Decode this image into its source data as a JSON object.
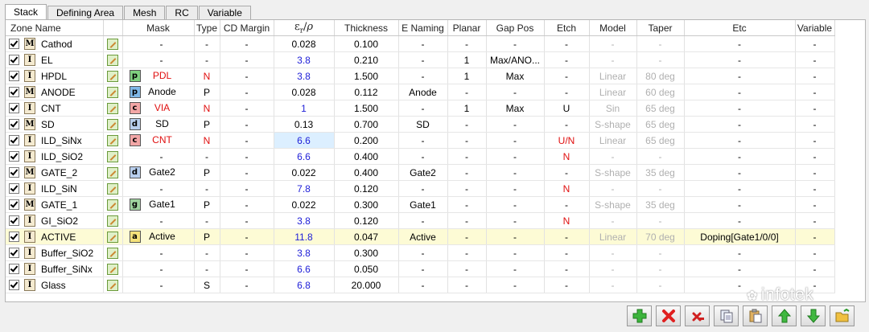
{
  "tabs": [
    "Stack",
    "Defining Area",
    "Mesh",
    "RC",
    "Variable"
  ],
  "active_tab": "Stack",
  "columns": [
    "Zone Name",
    "",
    "Mask",
    "Type",
    "CD Margin",
    "εr/ρ",
    "Thickness",
    "E Naming",
    "Planar",
    "Gap Pos",
    "Etch",
    "Model",
    "Taper",
    "Etc",
    "Variable"
  ],
  "rows": [
    {
      "name": "Cathod",
      "zt": "M",
      "mask_icon": "",
      "mask": "-",
      "type": "-",
      "cd": "-",
      "eps": "0.028",
      "thick": "0.100",
      "enaming": "-",
      "planar": "-",
      "gap": "-",
      "etch": "-",
      "model": "-",
      "taper": "-",
      "etc": "-",
      "variable": "-"
    },
    {
      "name": "EL",
      "zt": "I",
      "mask_icon": "",
      "mask": "-",
      "type": "-",
      "cd": "-",
      "eps": "3.8",
      "thick": "0.210",
      "enaming": "-",
      "planar": "1",
      "gap": "Max/ANO...",
      "etch": "-",
      "model": "-",
      "taper": "-",
      "etc": "-",
      "variable": "-"
    },
    {
      "name": "HPDL",
      "zt": "I",
      "mask_icon": "p",
      "mask": "PDL",
      "type": "N",
      "cd": "-",
      "eps": "3.8",
      "thick": "1.500",
      "enaming": "-",
      "planar": "1",
      "gap": "Max",
      "etch": "-",
      "model": "Linear",
      "taper": "80 deg",
      "etc": "-",
      "variable": "-"
    },
    {
      "name": "ANODE",
      "zt": "M",
      "mask_icon": "p",
      "mask": "Anode",
      "type": "P",
      "cd": "-",
      "eps": "0.028",
      "thick": "0.112",
      "enaming": "Anode",
      "planar": "-",
      "gap": "-",
      "etch": "-",
      "model": "Linear",
      "taper": "60 deg",
      "etc": "-",
      "variable": "-"
    },
    {
      "name": "CNT",
      "zt": "I",
      "mask_icon": "c",
      "mask": "VIA",
      "type": "N",
      "cd": "-",
      "eps": "1",
      "thick": "1.500",
      "enaming": "-",
      "planar": "1",
      "gap": "Max",
      "etch": "U",
      "model": "Sin",
      "taper": "65 deg",
      "etc": "-",
      "variable": "-"
    },
    {
      "name": "SD",
      "zt": "M",
      "mask_icon": "d",
      "mask": "SD",
      "type": "P",
      "cd": "-",
      "eps": "0.13",
      "thick": "0.700",
      "enaming": "SD",
      "planar": "-",
      "gap": "-",
      "etch": "-",
      "model": "S-shape",
      "taper": "65 deg",
      "etc": "-",
      "variable": "-"
    },
    {
      "name": "ILD_SiNx",
      "zt": "I",
      "mask_icon": "c",
      "mask": "CNT",
      "type": "N",
      "cd": "-",
      "eps": "6.6",
      "thick": "0.200",
      "enaming": "-",
      "planar": "-",
      "gap": "-",
      "etch": "U/N",
      "model": "Linear",
      "taper": "65 deg",
      "etc": "-",
      "variable": "-"
    },
    {
      "name": "ILD_SiO2",
      "zt": "I",
      "mask_icon": "",
      "mask": "-",
      "type": "-",
      "cd": "-",
      "eps": "6.6",
      "thick": "0.400",
      "enaming": "-",
      "planar": "-",
      "gap": "-",
      "etch": "N",
      "model": "-",
      "taper": "-",
      "etc": "-",
      "variable": "-"
    },
    {
      "name": "GATE_2",
      "zt": "M",
      "mask_icon": "d",
      "mask": "Gate2",
      "type": "P",
      "cd": "-",
      "eps": "0.022",
      "thick": "0.400",
      "enaming": "Gate2",
      "planar": "-",
      "gap": "-",
      "etch": "-",
      "model": "S-shape",
      "taper": "35 deg",
      "etc": "-",
      "variable": "-"
    },
    {
      "name": "ILD_SiN",
      "zt": "I",
      "mask_icon": "",
      "mask": "-",
      "type": "-",
      "cd": "-",
      "eps": "7.8",
      "thick": "0.120",
      "enaming": "-",
      "planar": "-",
      "gap": "-",
      "etch": "N",
      "model": "-",
      "taper": "-",
      "etc": "-",
      "variable": "-"
    },
    {
      "name": "GATE_1",
      "zt": "M",
      "mask_icon": "g",
      "mask": "Gate1",
      "type": "P",
      "cd": "-",
      "eps": "0.022",
      "thick": "0.300",
      "enaming": "Gate1",
      "planar": "-",
      "gap": "-",
      "etch": "-",
      "model": "S-shape",
      "taper": "35 deg",
      "etc": "-",
      "variable": "-"
    },
    {
      "name": "GI_SiO2",
      "zt": "I",
      "mask_icon": "",
      "mask": "-",
      "type": "-",
      "cd": "-",
      "eps": "3.8",
      "thick": "0.120",
      "enaming": "-",
      "planar": "-",
      "gap": "-",
      "etch": "N",
      "model": "-",
      "taper": "-",
      "etc": "-",
      "variable": "-"
    },
    {
      "name": "ACTIVE",
      "zt": "I",
      "mask_icon": "a",
      "mask": "Active",
      "type": "P",
      "cd": "-",
      "eps": "11.8",
      "thick": "0.047",
      "enaming": "Active",
      "planar": "-",
      "gap": "-",
      "etch": "-",
      "model": "Linear",
      "taper": "70 deg",
      "etc": "Doping[Gate1/0/0]",
      "variable": "-"
    },
    {
      "name": "Buffer_SiO2",
      "zt": "I",
      "mask_icon": "",
      "mask": "-",
      "type": "-",
      "cd": "-",
      "eps": "3.8",
      "thick": "0.300",
      "enaming": "-",
      "planar": "-",
      "gap": "-",
      "etch": "-",
      "model": "-",
      "taper": "-",
      "etc": "-",
      "variable": "-"
    },
    {
      "name": "Buffer_SiNx",
      "zt": "I",
      "mask_icon": "",
      "mask": "-",
      "type": "-",
      "cd": "-",
      "eps": "6.6",
      "thick": "0.050",
      "enaming": "-",
      "planar": "-",
      "gap": "-",
      "etch": "-",
      "model": "-",
      "taper": "-",
      "etc": "-",
      "variable": "-"
    },
    {
      "name": "Glass",
      "zt": "I",
      "mask_icon": "",
      "mask": "-",
      "type": "S",
      "cd": "-",
      "eps": "6.8",
      "thick": "20.000",
      "enaming": "-",
      "planar": "-",
      "gap": "-",
      "etch": "-",
      "model": "-",
      "taper": "-",
      "etc": "-",
      "variable": "-"
    }
  ],
  "watermark": "infotek",
  "toolbar_icons": [
    "add-icon",
    "delete-icon",
    "remove-icon",
    "copy-icon",
    "paste-icon",
    "move-up-icon",
    "move-down-icon",
    "open-folder-icon"
  ]
}
